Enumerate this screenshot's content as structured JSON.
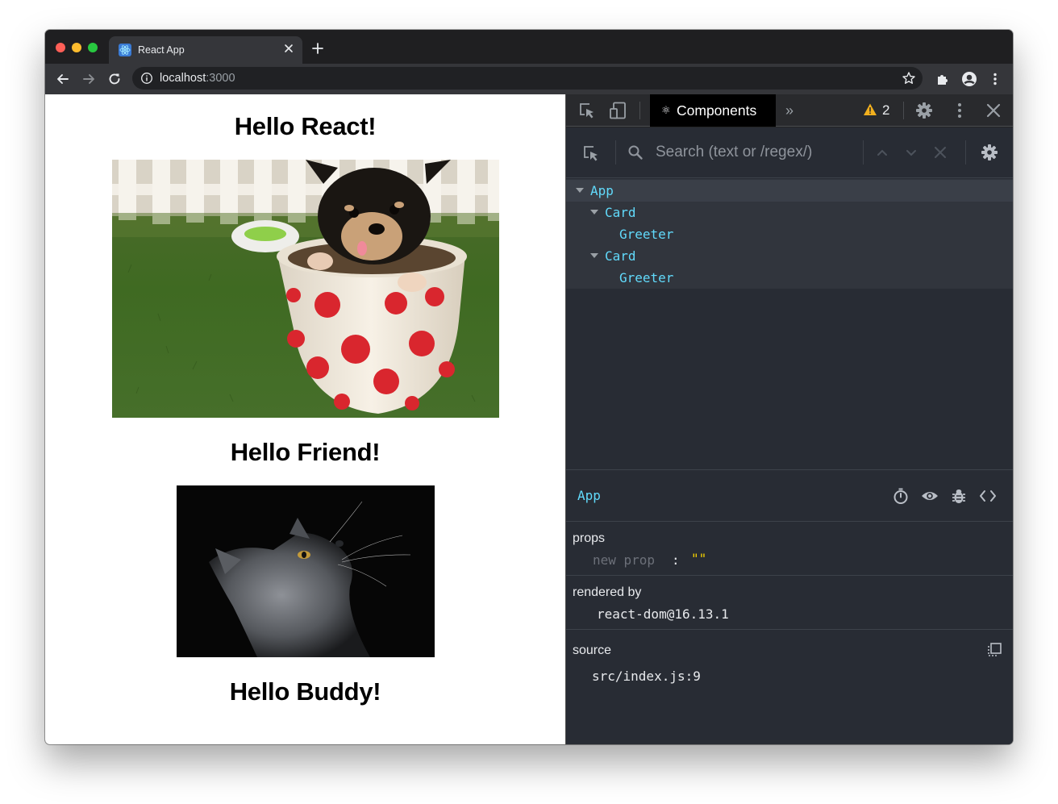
{
  "browser": {
    "tab_title": "React App",
    "url_host": "localhost",
    "url_port": ":3000"
  },
  "page": {
    "greetings": [
      "Hello React!",
      "Hello Friend!",
      "Hello Buddy!"
    ]
  },
  "devtools": {
    "active_tab": "Components",
    "warning_count": "2",
    "search_placeholder": "Search (text or /regex/)",
    "tree": [
      {
        "name": "App",
        "depth": 0,
        "expandable": true
      },
      {
        "name": "Card",
        "depth": 1,
        "expandable": true
      },
      {
        "name": "Greeter",
        "depth": 2,
        "expandable": false
      },
      {
        "name": "Card",
        "depth": 1,
        "expandable": true
      },
      {
        "name": "Greeter",
        "depth": 2,
        "expandable": false
      }
    ],
    "selected_component": "App",
    "props_title": "props",
    "new_prop_placeholder": "new prop",
    "new_prop_colon": ":",
    "new_prop_value": "\"\"",
    "rendered_by_title": "rendered by",
    "rendered_by_value": "react-dom@16.13.1",
    "source_title": "source",
    "source_value": "src/index.js:9"
  },
  "colors": {
    "component_name": "#61dafb",
    "string_value": "#f3d000",
    "devtools_bg": "#282c34"
  }
}
